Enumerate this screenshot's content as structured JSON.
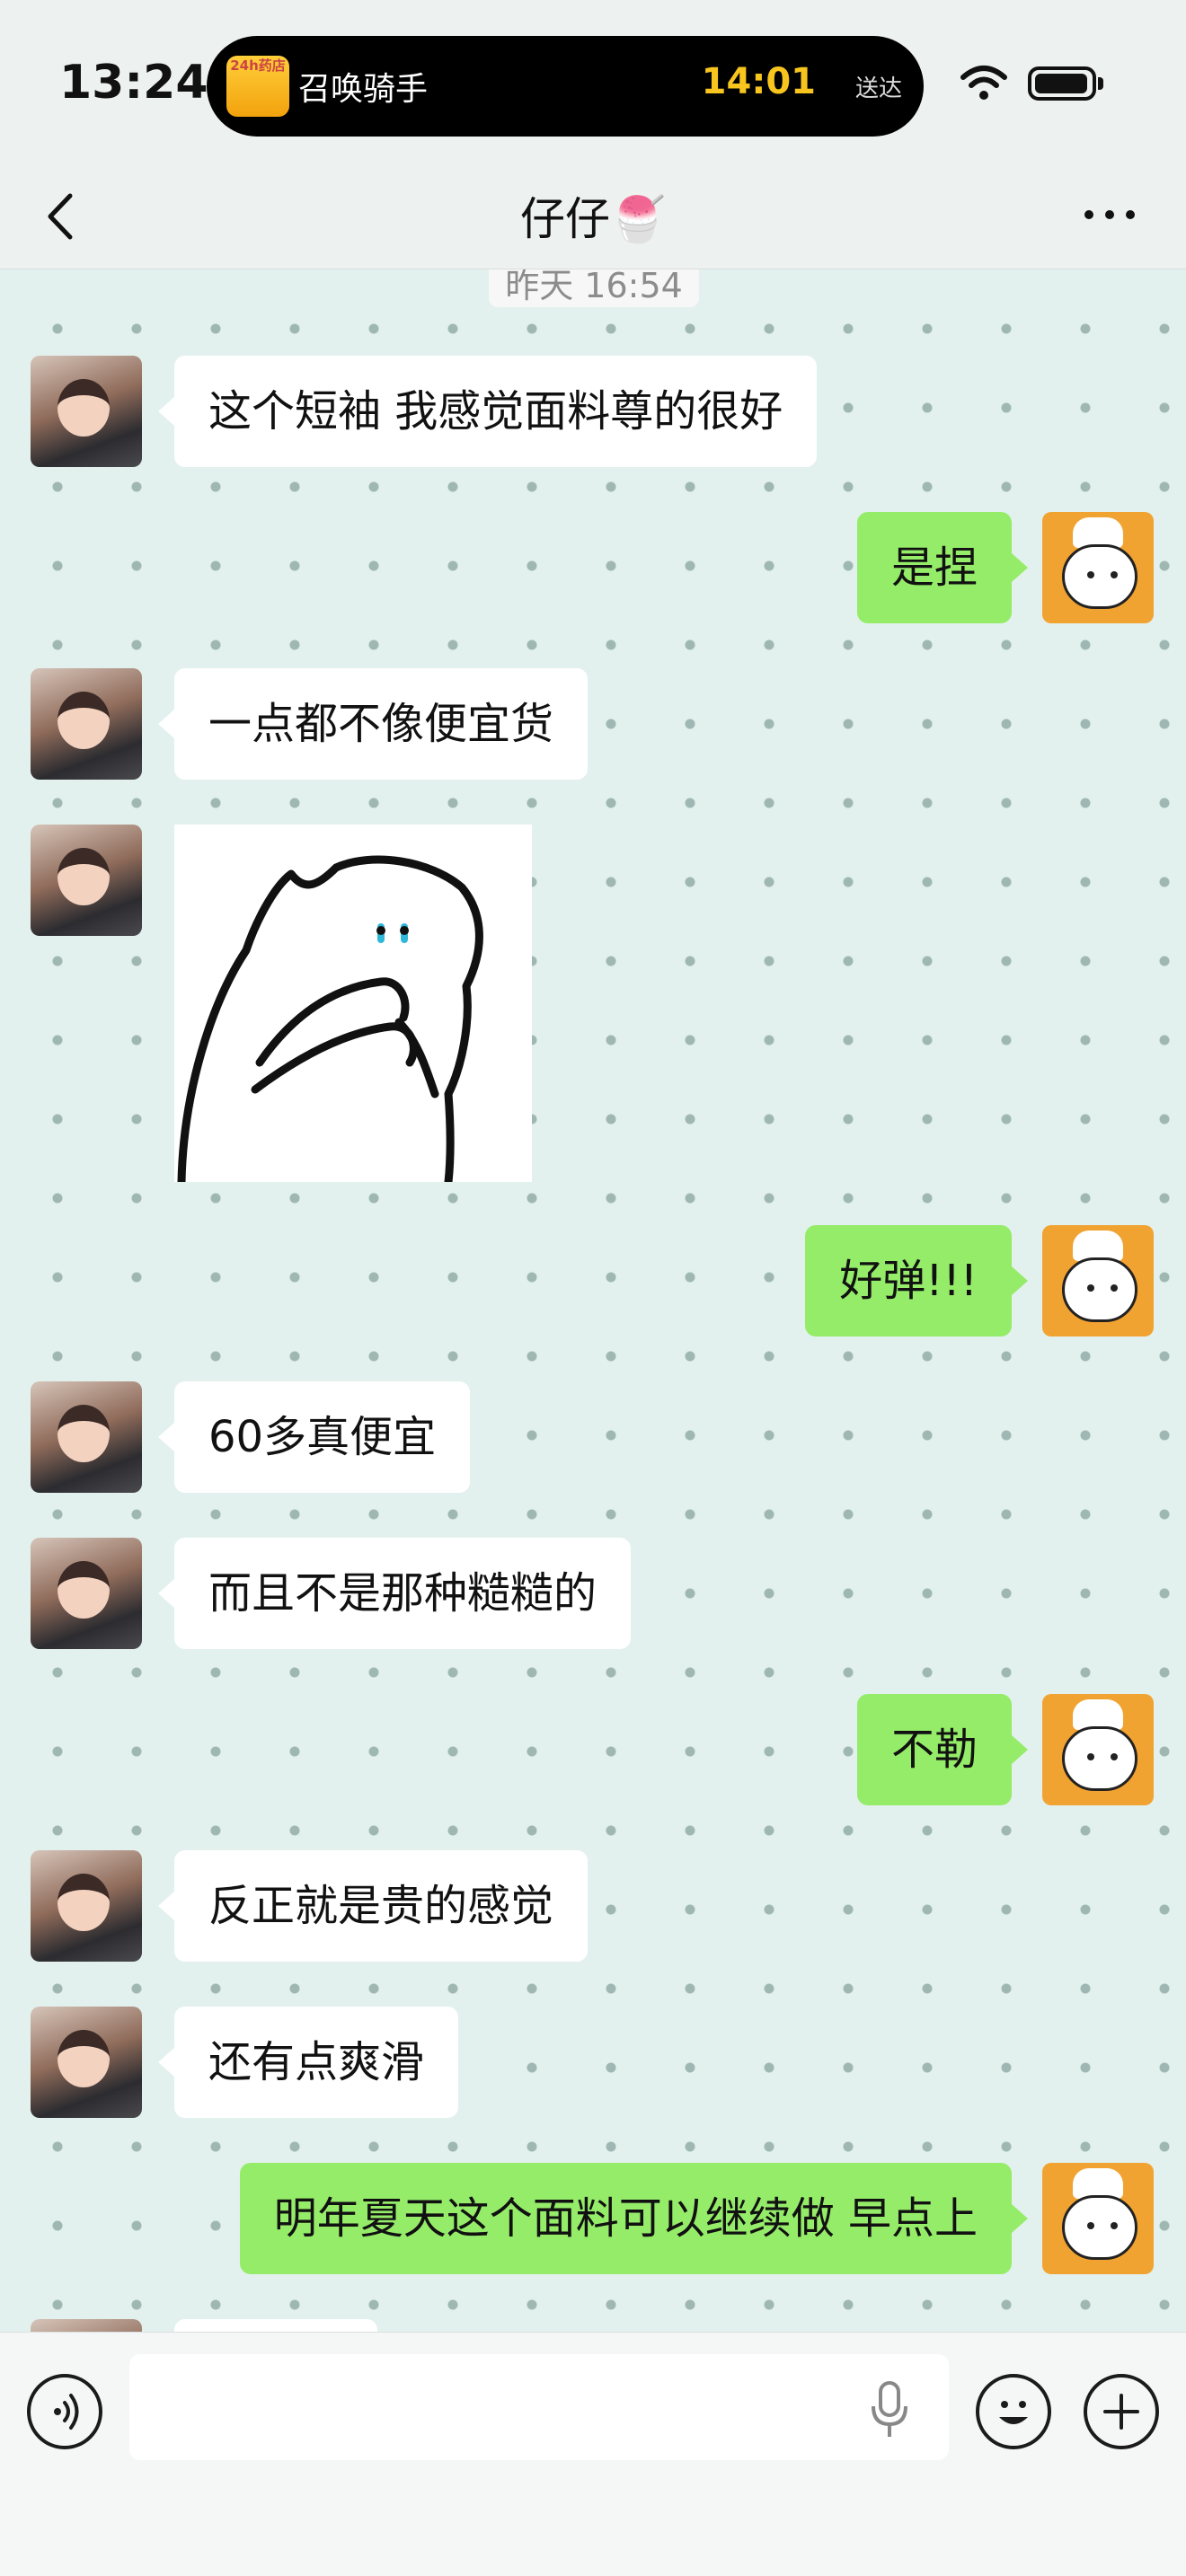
{
  "status_bar": {
    "time": "13:24",
    "live_activity": {
      "icon_text": "24h药店",
      "title": "召唤骑手",
      "eta": "14:01",
      "eta_suffix": "送达"
    }
  },
  "nav": {
    "title": "仔仔🍧"
  },
  "chat": {
    "timestamp": "昨天 16:54",
    "messages": [
      {
        "side": "other",
        "text": "这个短袖 我感觉面料尊的很好"
      },
      {
        "side": "me",
        "text": "是捏"
      },
      {
        "side": "other",
        "text": "一点都不像便宜货"
      },
      {
        "side": "other",
        "type": "sticker",
        "sticker": "crying-cat-sticker"
      },
      {
        "side": "me",
        "text": "好弹!!!"
      },
      {
        "side": "other",
        "text": "60多真便宜"
      },
      {
        "side": "other",
        "text": "而且不是那种糙糙的"
      },
      {
        "side": "me",
        "text": "不勒"
      },
      {
        "side": "other",
        "text": "反正就是贵的感觉"
      },
      {
        "side": "other",
        "text": "还有点爽滑"
      },
      {
        "side": "me",
        "text": "明年夏天这个面料可以继续做 早点上"
      }
    ]
  },
  "input_bar": {
    "placeholder": "",
    "icons": [
      "voice-icon",
      "microphone-icon",
      "emoji-icon",
      "plus-icon"
    ]
  },
  "colors": {
    "my_bubble": "#95ec69",
    "their_bubble": "#ffffff",
    "eta_yellow": "#f7c51e"
  }
}
